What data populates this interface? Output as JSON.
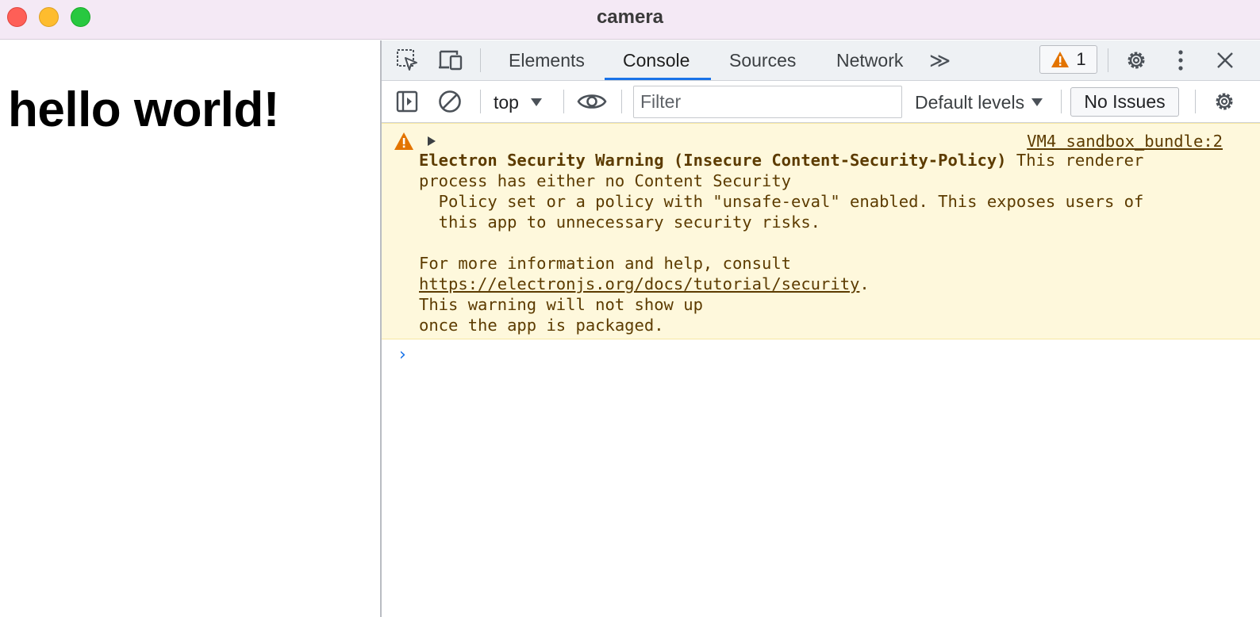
{
  "window": {
    "title": "camera"
  },
  "page": {
    "heading": "hello world!"
  },
  "devtools": {
    "tabs": [
      {
        "label": "Elements",
        "active": false
      },
      {
        "label": "Console",
        "active": true
      },
      {
        "label": "Sources",
        "active": false
      },
      {
        "label": "Network",
        "active": false
      }
    ],
    "more_tabs_glyph": "≫",
    "warning_count": "1",
    "console_toolbar": {
      "context": "top",
      "filter_placeholder": "Filter",
      "levels": "Default levels",
      "issues": "No Issues"
    },
    "messages": [
      {
        "level": "warning",
        "source": "VM4 sandbox_bundle:2",
        "title": "Electron Security Warning (Insecure Content-Security-Policy)",
        "line1_rest": " This renderer",
        "line2": "process has either no Content Security",
        "line3": "  Policy set or a policy with \"unsafe-eval\" enabled. This exposes users of",
        "line4": "  this app to unnecessary security risks.",
        "line5": "For more information and help, consult",
        "link": "https://electronjs.org/docs/tutorial/security",
        "link_suffix": ".",
        "line7": "This warning will not show up",
        "line8": "once the app is packaged."
      }
    ],
    "prompt_glyph": "›"
  },
  "colors": {
    "titlebar_bg": "#f4e9f5",
    "warning_bg": "#fef8dc",
    "warning_text": "#5c3b00",
    "accent": "#1a73e8",
    "warning_icon": "#e37400"
  }
}
